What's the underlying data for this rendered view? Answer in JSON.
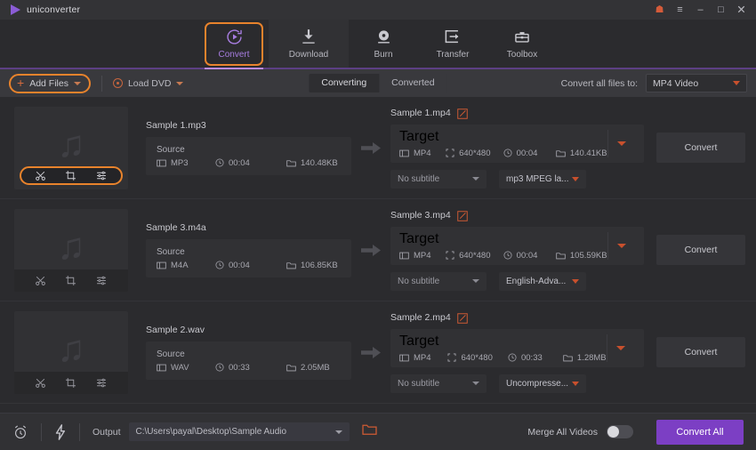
{
  "window": {
    "app_title": "uniconverter",
    "controls": [
      {
        "name": "gift-icon",
        "glyph": "☗"
      },
      {
        "name": "menu-icon",
        "glyph": "≡"
      },
      {
        "name": "minimize-icon",
        "glyph": "–"
      },
      {
        "name": "maximize-icon",
        "glyph": "□"
      },
      {
        "name": "close-icon",
        "glyph": "✕"
      }
    ],
    "accent_orange": "#e8832c",
    "accent_purple": "#7c3fc4",
    "divider_purple": "#5c3f84"
  },
  "nav": {
    "items": [
      {
        "label": "Convert",
        "icon": "convert-icon",
        "active": true
      },
      {
        "label": "Download",
        "icon": "download-icon",
        "active": false
      },
      {
        "label": "Burn",
        "icon": "burn-icon",
        "active": false
      },
      {
        "label": "Transfer",
        "icon": "transfer-icon",
        "active": false
      },
      {
        "label": "Toolbox",
        "icon": "toolbox-icon",
        "active": false
      }
    ]
  },
  "toolbar": {
    "add_files_label": "Add Files",
    "load_dvd_label": "Load DVD",
    "tabs": [
      {
        "label": "Converting",
        "selected": true
      },
      {
        "label": "Converted",
        "selected": false
      }
    ],
    "convert_all_to_label": "Convert all files to:",
    "convert_all_to_value": "MP4 Video"
  },
  "list": {
    "source_label": "Source",
    "target_label": "Target",
    "convert_button_label": "Convert",
    "rows": [
      {
        "file_name": "Sample 1.mp3",
        "thumb_icon": "music-note-icon",
        "tools_highlighted": true,
        "tools": [
          "trim-icon",
          "crop-icon",
          "effect-icon"
        ],
        "source": {
          "format": "MP3",
          "duration": "00:04",
          "size": "140.48KB"
        },
        "target_name": "Sample 1.mp4",
        "target": {
          "format": "MP4",
          "resolution": "640*480",
          "duration": "00:04",
          "size": "140.41KB"
        },
        "subtitle": "No subtitle",
        "audio_track": "mp3 MPEG la..."
      },
      {
        "file_name": "Sample 3.m4a",
        "thumb_icon": "music-note-icon",
        "tools_highlighted": false,
        "tools": [
          "trim-icon",
          "crop-icon",
          "effect-icon"
        ],
        "source": {
          "format": "M4A",
          "duration": "00:04",
          "size": "106.85KB"
        },
        "target_name": "Sample 3.mp4",
        "target": {
          "format": "MP4",
          "resolution": "640*480",
          "duration": "00:04",
          "size": "105.59KB"
        },
        "subtitle": "No subtitle",
        "audio_track": "English-Adva..."
      },
      {
        "file_name": "Sample 2.wav",
        "thumb_icon": "music-note-icon",
        "tools_highlighted": false,
        "tools": [
          "trim-icon",
          "crop-icon",
          "effect-icon"
        ],
        "source": {
          "format": "WAV",
          "duration": "00:33",
          "size": "2.05MB"
        },
        "target_name": "Sample 2.mp4",
        "target": {
          "format": "MP4",
          "resolution": "640*480",
          "duration": "00:33",
          "size": "1.28MB"
        },
        "subtitle": "No subtitle",
        "audio_track": "Uncompresse..."
      }
    ]
  },
  "bottom": {
    "alarm_icon": "alarm-clock-icon",
    "bolt_icon": "lightning-bolt-icon",
    "output_label": "Output",
    "output_path": "C:\\Users\\payal\\Desktop\\Sample Audio",
    "folder_icon": "open-folder-icon",
    "merge_label": "Merge All Videos",
    "merge_enabled": false,
    "convert_all_label": "Convert All"
  }
}
